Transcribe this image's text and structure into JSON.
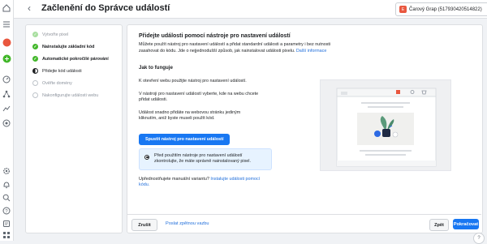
{
  "header": {
    "title": "Začlenění do Správce událostí",
    "account_initial": "E",
    "account_label": "Čarový Grap (517930420514822)"
  },
  "steps": [
    {
      "label": "Vytvořte pixel",
      "state": "done"
    },
    {
      "label": "Nainstalujte základní kód",
      "state": "done"
    },
    {
      "label": "Automatické pokročilé párování",
      "state": "done"
    },
    {
      "label": "Přidejte kód události",
      "state": "current"
    },
    {
      "label": "Ověřte domény",
      "state": "pending"
    },
    {
      "label": "Nakonfigurujte události webu",
      "state": "pending"
    }
  ],
  "main": {
    "heading": "Přidejte události pomocí nástroje pro nastavení událostí",
    "intro": "Můžete použít nástroj pro nastavení událostí a přidat standardní události a parametry i bez nutnosti zasahovat do kódu. Jde o nejjednodušší způsob, jak nainstalovat události pixelu.",
    "intro_link": "Další informace",
    "how_heading": "Jak to funguje",
    "how_p1": "K otevření webu použijte nástroj pro nastavení událostí.",
    "how_p2": "V nástroji pro nastavení událostí vyberte, kde na webu chcete přidat události.",
    "how_p3": "Událost snadno přidáte na webovou stránku jediným kliknutím, aniž byste museli použít kód.",
    "launch_button": "Spustit nástroj pro nastavení událostí",
    "note": "Před použitím nástroje pro nastavení událostí zkontrolujte, že máte správně nainstalovaný pixel.",
    "manual_text": "Upřednostňujete manuální variantu?",
    "manual_link": "Instalujte události pomocí kódu."
  },
  "footer": {
    "cancel": "Zrušit",
    "feedback": "Poslat zpětnou vazbu",
    "back": "Zpět",
    "next": "Pokračovat"
  },
  "colors": {
    "accent": "#1877f2",
    "done": "#42b72a",
    "brand_badge": "#e9573f",
    "plant_leaf": "#5a9a7a",
    "ball": "#2d6ae3"
  }
}
